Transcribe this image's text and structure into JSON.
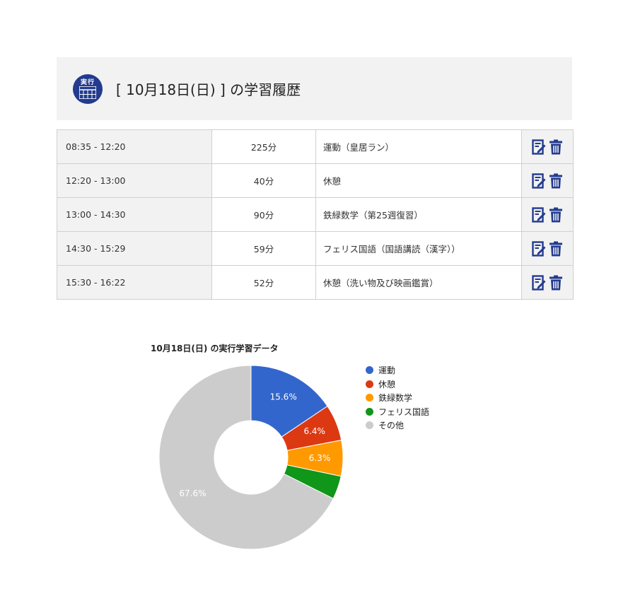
{
  "header": {
    "badge_text": "実行",
    "title": "[ 10月18日(日) ] の学習履歴"
  },
  "log": {
    "rows": [
      {
        "time": "08:35 - 12:20",
        "minutes": "225分",
        "activity": "運動（皇居ラン）"
      },
      {
        "time": "12:20 - 13:00",
        "minutes": "40分",
        "activity": "休憩"
      },
      {
        "time": "13:00 - 14:30",
        "minutes": "90分",
        "activity": "鉄緑数学（第25週復習）"
      },
      {
        "time": "14:30 - 15:29",
        "minutes": "59分",
        "activity": "フェリス国語（国語講読（漢字））"
      },
      {
        "time": "15:30 - 16:22",
        "minutes": "52分",
        "activity": "休憩（洗い物及び映画鑑賞）"
      }
    ],
    "edit_icon": "edit-icon",
    "delete_icon": "trash-icon",
    "icon_color": "#233b8e"
  },
  "chart_data": {
    "type": "pie",
    "donut": true,
    "title": "10月18日(日) の実行学習データ",
    "legend_position": "right",
    "categories": [
      "運動",
      "休憩",
      "鉄緑数学",
      "フェリス国語",
      "その他"
    ],
    "values": [
      15.6,
      6.4,
      6.3,
      4.1,
      67.6
    ],
    "labels": [
      "15.6%",
      "6.4%",
      "6.3%",
      "",
      "67.6%"
    ],
    "colors": [
      "#3366cc",
      "#dc3912",
      "#ff9900",
      "#109618",
      "#cccccc"
    ]
  }
}
